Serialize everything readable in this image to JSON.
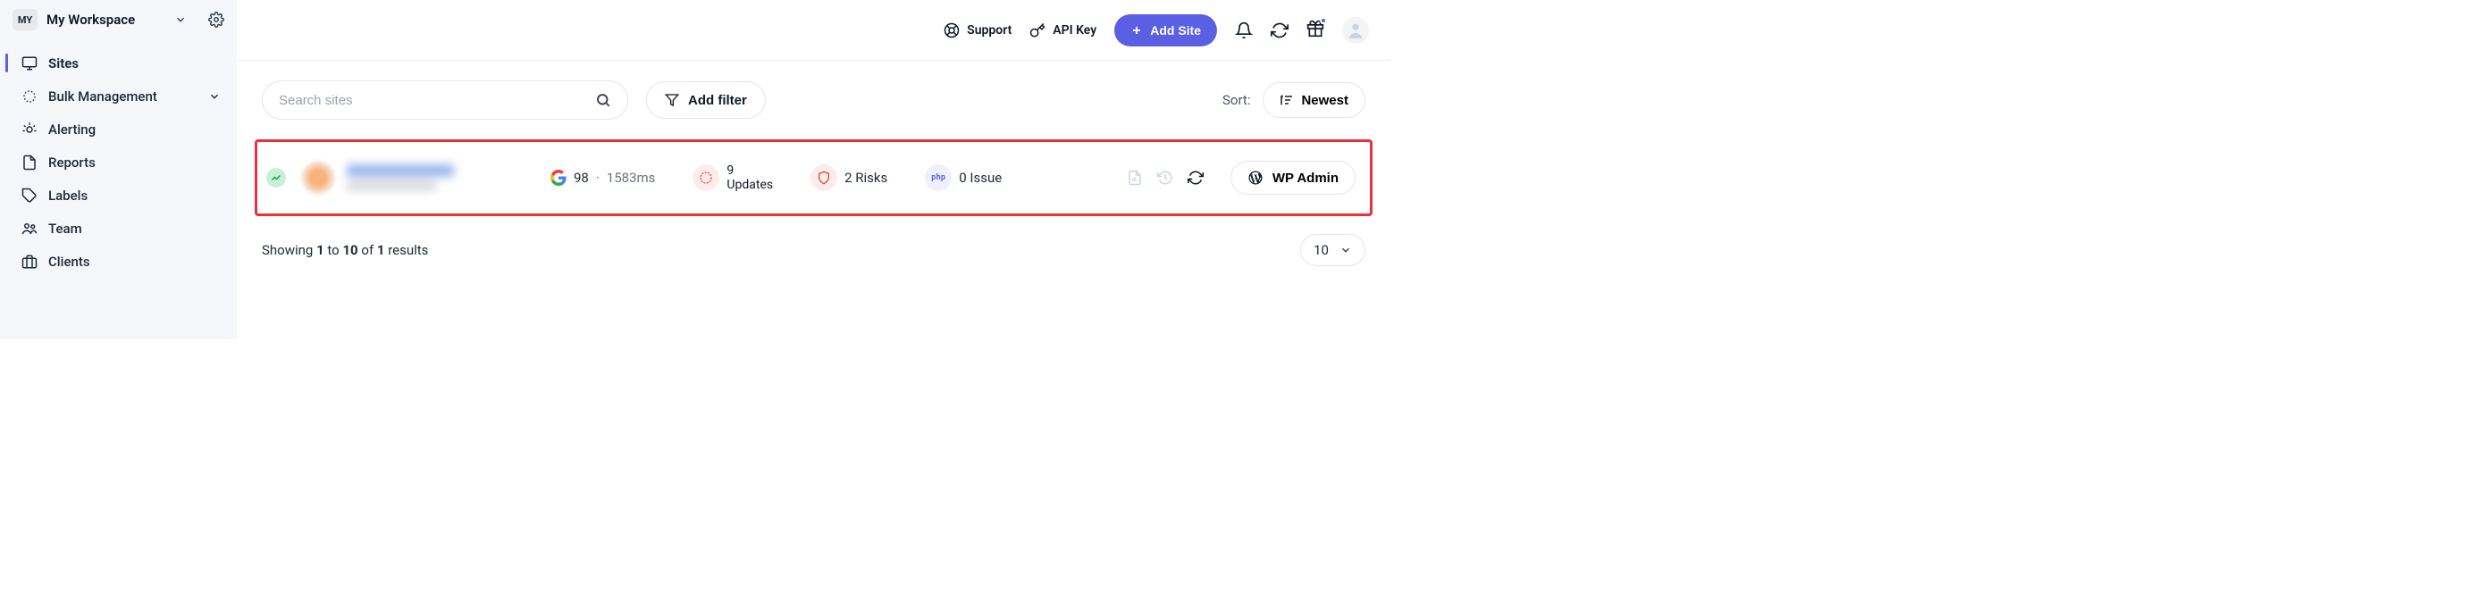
{
  "workspace": {
    "badge": "MY",
    "name": "My Workspace"
  },
  "sidebar": {
    "items": [
      {
        "label": "Sites",
        "active": true
      },
      {
        "label": "Bulk Management",
        "expandable": true
      },
      {
        "label": "Alerting"
      },
      {
        "label": "Reports"
      },
      {
        "label": "Labels"
      },
      {
        "label": "Team"
      },
      {
        "label": "Clients"
      }
    ]
  },
  "topbar": {
    "support": "Support",
    "api_key": "API Key",
    "add_site": "Add Site"
  },
  "toolbar": {
    "search_placeholder": "Search sites",
    "add_filter": "Add filter",
    "sort_label": "Sort:",
    "sort_value": "Newest"
  },
  "site_row": {
    "pagespeed_score": "98",
    "load_time": "1583ms",
    "separator": "·",
    "updates_count": "9",
    "updates_label": "Updates",
    "risks": "2 Risks",
    "php_issue": "0 Issue",
    "php_badge": "php",
    "wp_admin": "WP Admin"
  },
  "footer": {
    "prefix": "Showing ",
    "from": "1",
    "to_word": " to ",
    "to": "10",
    "of_word": " of ",
    "total": "1",
    "suffix": " results",
    "page_size": "10"
  }
}
